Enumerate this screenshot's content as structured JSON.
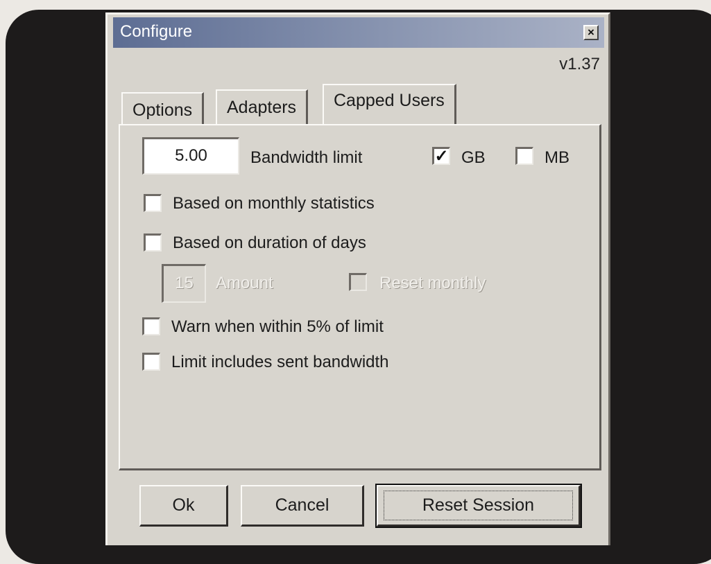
{
  "window": {
    "title": "Configure",
    "close_glyph": "×",
    "version": "v1.37"
  },
  "tabs": [
    {
      "label": "Options",
      "active": false
    },
    {
      "label": "Adapters",
      "active": false
    },
    {
      "label": "Capped Users",
      "active": true
    }
  ],
  "bandwidth": {
    "value": "5.00",
    "label": "Bandwidth limit",
    "gb": {
      "label": "GB",
      "checked": true,
      "mark": "✓"
    },
    "mb": {
      "label": "MB",
      "checked": false,
      "mark": ""
    }
  },
  "options": {
    "monthly": {
      "label": "Based on monthly statistics",
      "checked": false
    },
    "duration": {
      "label": "Based on duration of days",
      "checked": false
    },
    "amount": {
      "value": "15",
      "label": "Amount",
      "enabled": false
    },
    "reset_monthly": {
      "label": "Reset monthly",
      "enabled": false,
      "checked": false
    },
    "warn": {
      "label": "Warn when within 5% of limit",
      "checked": false
    },
    "sent": {
      "label": "Limit includes sent bandwidth",
      "checked": false
    }
  },
  "buttons": {
    "ok": "Ok",
    "cancel": "Cancel",
    "reset": "Reset Session"
  }
}
